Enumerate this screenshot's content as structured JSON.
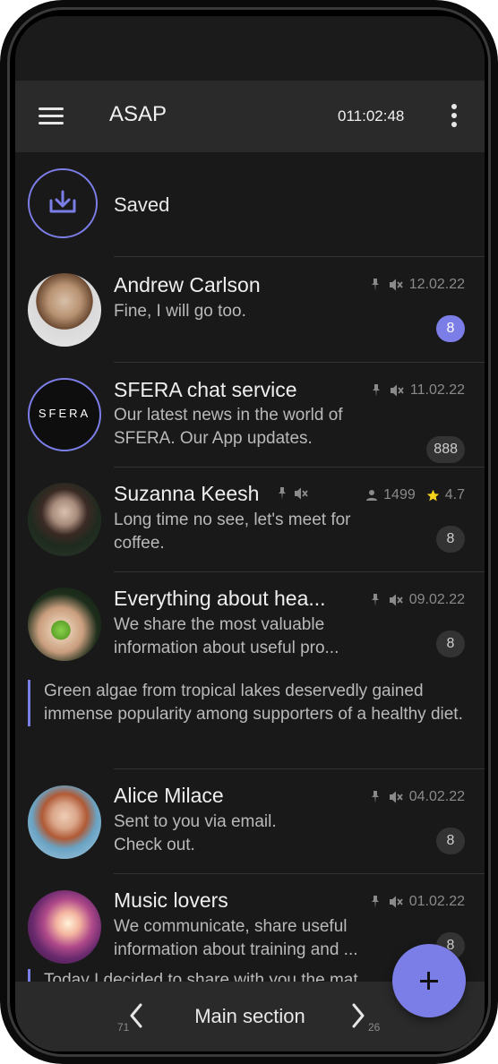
{
  "app": {
    "title": "ASAP",
    "clock": "011:02:48"
  },
  "saved": {
    "label": "Saved"
  },
  "chats": [
    {
      "name": "Andrew Carlson",
      "preview": "Fine, I will go too.",
      "date": "12.02.22",
      "badge": "8",
      "pinned": true,
      "muted": true
    },
    {
      "name": "SFERA chat service",
      "preview": "Our latest news in the world of SFERA. Our App updates.",
      "date": "11.02.22",
      "badge": "888",
      "logo_text": "SFERA",
      "pinned": true,
      "muted": true
    },
    {
      "name": "Suzanna Keesh",
      "preview": "Long time no see, let's meet for coffee.",
      "members": "1499",
      "rating": "4.7",
      "badge": "8",
      "pinned": true,
      "muted": true
    },
    {
      "name": "Everything about hea...",
      "preview": "We share the most valuable information about useful pro...",
      "date": "09.02.22",
      "badge": "8",
      "quote": "Green algae from tropical lakes deservedly gained immense popularity among supporters of a healthy diet.",
      "pinned": true,
      "muted": true
    },
    {
      "name": "Alice Milace",
      "preview": "Sent to you via email. Check out.",
      "date": "04.02.22",
      "badge": "8",
      "pinned": true,
      "muted": true
    },
    {
      "name": "Music lovers",
      "preview": "We communicate, share useful information about training and ...",
      "date": "01.02.22",
      "badge": "8",
      "quote": "Today I decided to share with you the mat",
      "pinned": true,
      "muted": true
    }
  ],
  "bottom_nav": {
    "title": "Main section",
    "prev_count": "71",
    "next_count": "26"
  },
  "colors": {
    "accent": "#7c7ee8",
    "background": "#191919",
    "bar": "#2a2a2a"
  },
  "icons": [
    "menu-icon",
    "more-vertical-icon",
    "download-icon",
    "pin-icon",
    "mute-icon",
    "user-icon",
    "star-icon",
    "chevron-left-icon",
    "chevron-right-icon",
    "plus-icon"
  ]
}
